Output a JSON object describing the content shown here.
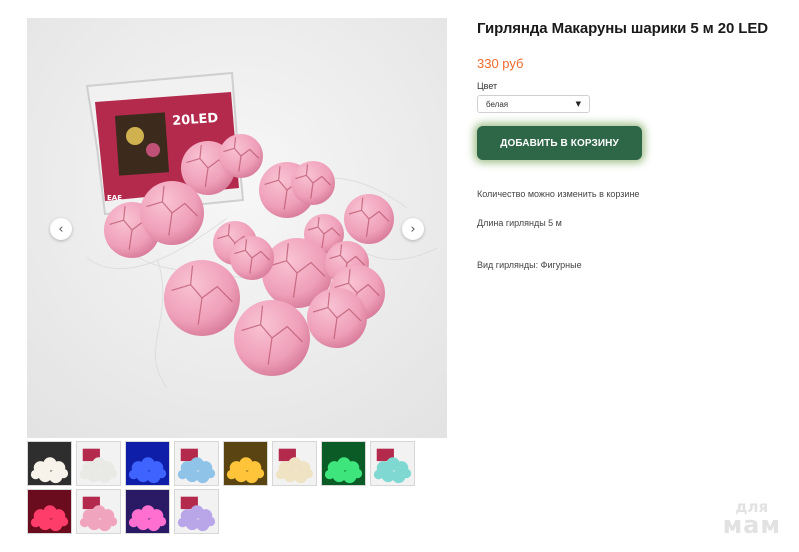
{
  "product": {
    "title": "Гирлянда Макаруны шарики 5 м 20 LED",
    "price": "330 руб",
    "color_label": "Цвет",
    "color_selected": "белая",
    "add_to_cart": "ДОБАВИТЬ В КОРЗИНУ",
    "qty_note": "Количество можно изменить в корзине",
    "length_note": "Длина гирлянды 5 м",
    "type_note": "Вид гирлянды: Фигурные"
  },
  "gallery": {
    "box_label": "20LED",
    "box_mark": "ЕАЕ",
    "prev_arrow": "‹",
    "next_arrow": "›",
    "ball_color": "#f0a4bd",
    "thumbnails": [
      {
        "name": "warm-white-lit",
        "bg": "#2e2e2e",
        "ball": "#f7f3ea"
      },
      {
        "name": "white",
        "bg": "#f2f2f2",
        "ball": "#e9e9e6"
      },
      {
        "name": "blue-lit",
        "bg": "#0e1ea8",
        "ball": "#3f63ff"
      },
      {
        "name": "blue",
        "bg": "#f2f2f2",
        "ball": "#8fc3e8"
      },
      {
        "name": "yellow-lit",
        "bg": "#5a4512",
        "ball": "#ffc43a"
      },
      {
        "name": "cream",
        "bg": "#f2f2f2",
        "ball": "#efe3c4"
      },
      {
        "name": "green-lit",
        "bg": "#0b5b26",
        "ball": "#3ee57c"
      },
      {
        "name": "turquoise",
        "bg": "#f2f2f2",
        "ball": "#7fd8d2"
      },
      {
        "name": "red-lit",
        "bg": "#6b0b1e",
        "ball": "#ff3d6a"
      },
      {
        "name": "pink",
        "bg": "#f2f2f2",
        "ball": "#f0a4bd"
      },
      {
        "name": "multicolor-lit",
        "bg": "#2a1a66",
        "ball": "#ff6fd0"
      },
      {
        "name": "multicolor",
        "bg": "#f2f2f2",
        "ball": "#b9a6e8"
      }
    ]
  },
  "watermark": {
    "line1": "для",
    "line2": "мам"
  }
}
